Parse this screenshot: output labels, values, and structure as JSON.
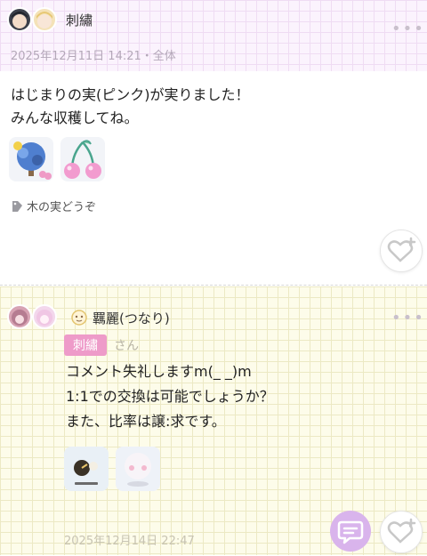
{
  "post": {
    "author": "刺繡",
    "meta": "2025年12月11日 14:21・全体",
    "text": "はじまりの実(ピンク)が実りました！\nみんな収穫してね。",
    "tag": "木の実どうぞ"
  },
  "comment": {
    "author": "羈麗(つなり)",
    "reply_to": "刺繡",
    "reply_suffix": "さん",
    "text": "コメント失礼しますm(_ _)m\n1:1での交換は可能でしょうか？\nまた、比率は譲:求です。",
    "timestamp": "2025年12月14日 22:47"
  },
  "icons": {
    "more": "more-dots-icon",
    "tag": "tag-icon",
    "like": "heart-plus-icon",
    "chat": "chat-bubble-icon"
  },
  "colors": {
    "accent_pink": "#ee9bc9",
    "chat_purple": "#d9b4ec",
    "header_grid": "#fbf3fd",
    "comment_grid": "#fdfcea"
  }
}
